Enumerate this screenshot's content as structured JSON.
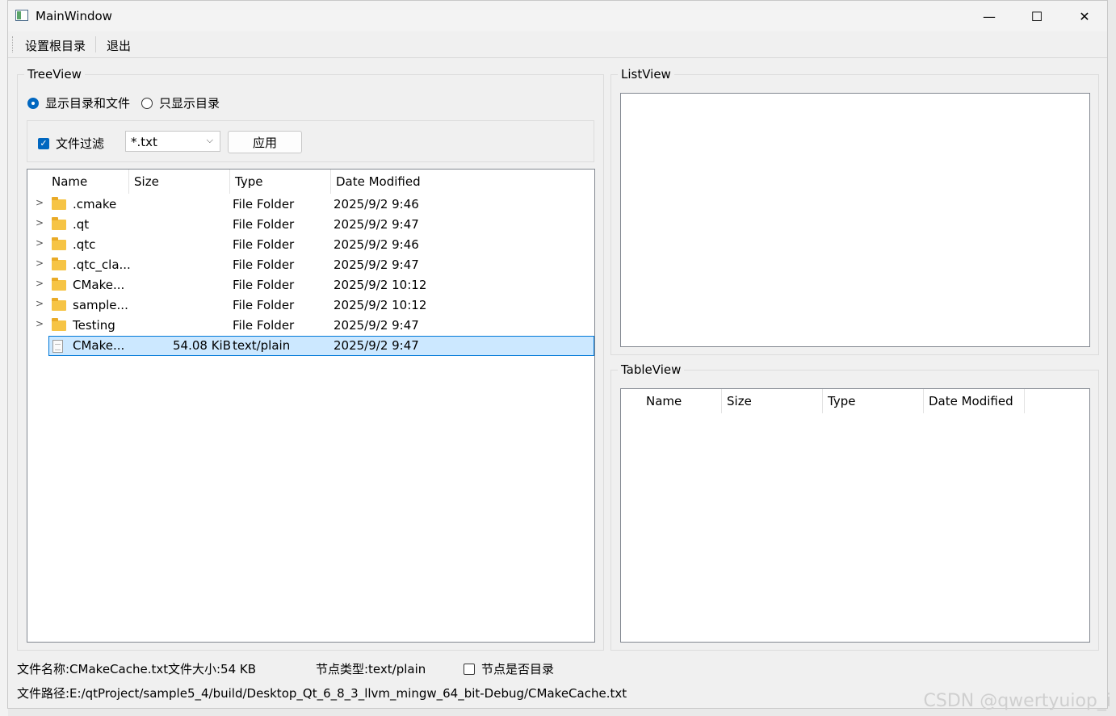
{
  "window": {
    "title": "MainWindow",
    "minimize": "—",
    "maximize": "☐",
    "close": "✕"
  },
  "menu": {
    "set_root": "设置根目录",
    "exit": "退出"
  },
  "treeview": {
    "title": "TreeView",
    "radio_all": "显示目录和文件",
    "radio_dirs": "只显示目录",
    "filter_label": "文件过滤",
    "filter_value": "*.txt",
    "apply": "应用",
    "headers": [
      "Name",
      "Size",
      "Type",
      "Date Modified"
    ],
    "rows": [
      {
        "name": ".cmake",
        "size": "",
        "type": "File Folder",
        "date": "2025/9/2 9:46"
      },
      {
        "name": ".qt",
        "size": "",
        "type": "File Folder",
        "date": "2025/9/2 9:47"
      },
      {
        "name": ".qtc",
        "size": "",
        "type": "File Folder",
        "date": "2025/9/2 9:46"
      },
      {
        "name": ".qtc_cla...",
        "size": "",
        "type": "File Folder",
        "date": "2025/9/2 9:47"
      },
      {
        "name": "CMake...",
        "size": "",
        "type": "File Folder",
        "date": "2025/9/2 10:12"
      },
      {
        "name": "sample...",
        "size": "",
        "type": "File Folder",
        "date": "2025/9/2 10:12"
      },
      {
        "name": "Testing",
        "size": "",
        "type": "File Folder",
        "date": "2025/9/2 9:47"
      },
      {
        "name": "CMake...",
        "size": "54.08 KiB",
        "type": "text/plain",
        "date": "2025/9/2 9:47"
      }
    ]
  },
  "listview": {
    "title": "ListView"
  },
  "tableview": {
    "title": "TableView",
    "headers": [
      "Name",
      "Size",
      "Type",
      "Date Modified"
    ]
  },
  "status": {
    "file_name": "文件名称:CMakeCache.txt",
    "file_size": "文件大小:54 KB",
    "node_type": "节点类型:text/plain",
    "is_dir": "节点是否目录",
    "file_path": "文件路径:E:/qtProject/sample5_4/build/Desktop_Qt_6_8_3_llvm_mingw_64_bit-Debug/CMakeCache.txt"
  },
  "watermark": "CSDN @qwertyuiop_i"
}
